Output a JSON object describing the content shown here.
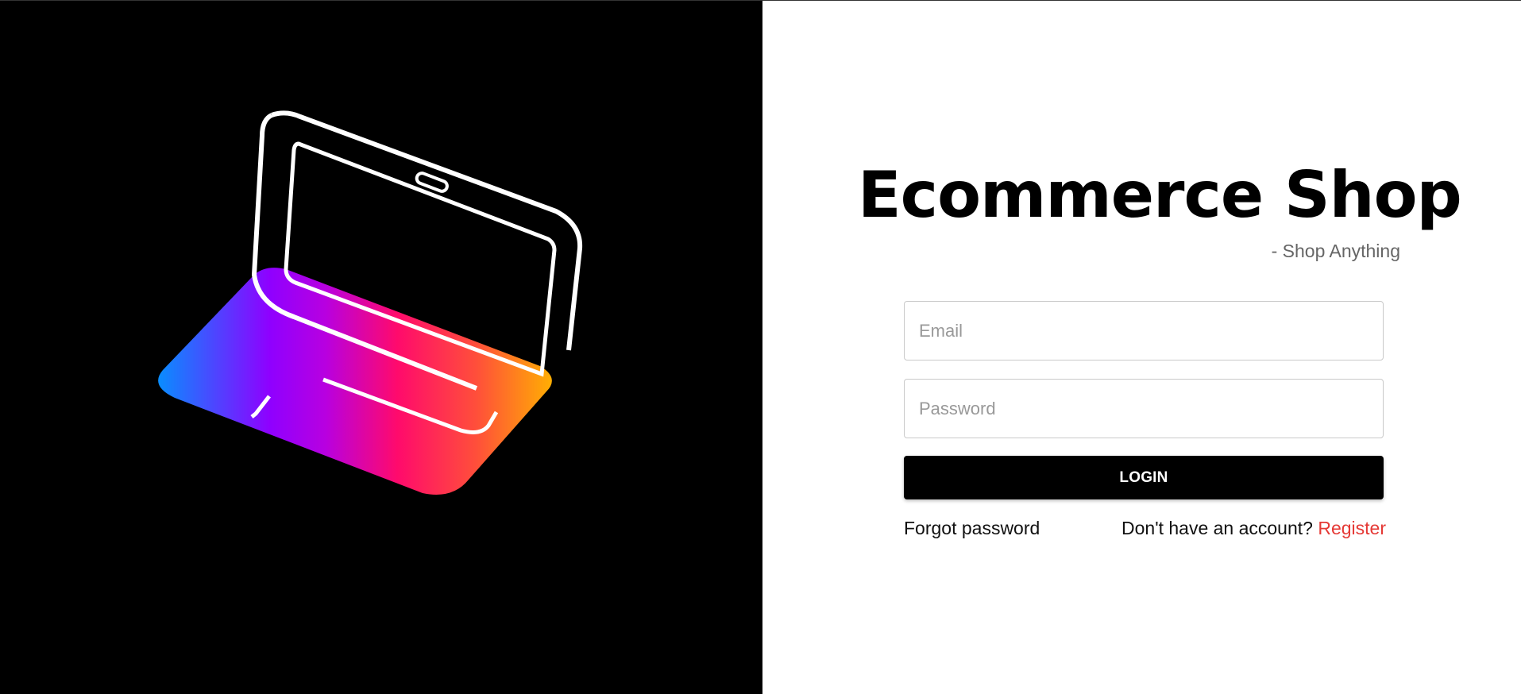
{
  "hero": {
    "illustration": "laptop-illustration",
    "gradient_colors": [
      "#0a8cff",
      "#9400ff",
      "#ff0a6c",
      "#ffb300"
    ]
  },
  "brand": {
    "title": "Ecommerce Shop",
    "subtitle": "- Shop Anything"
  },
  "form": {
    "email_placeholder": "Email",
    "password_placeholder": "Password",
    "login_label": "LOGIN",
    "forgot_label": "Forgot password",
    "no_account_text": "Don't have an account?",
    "register_label": "Register"
  },
  "colors": {
    "accent": "#e53935",
    "button": "#000000"
  }
}
